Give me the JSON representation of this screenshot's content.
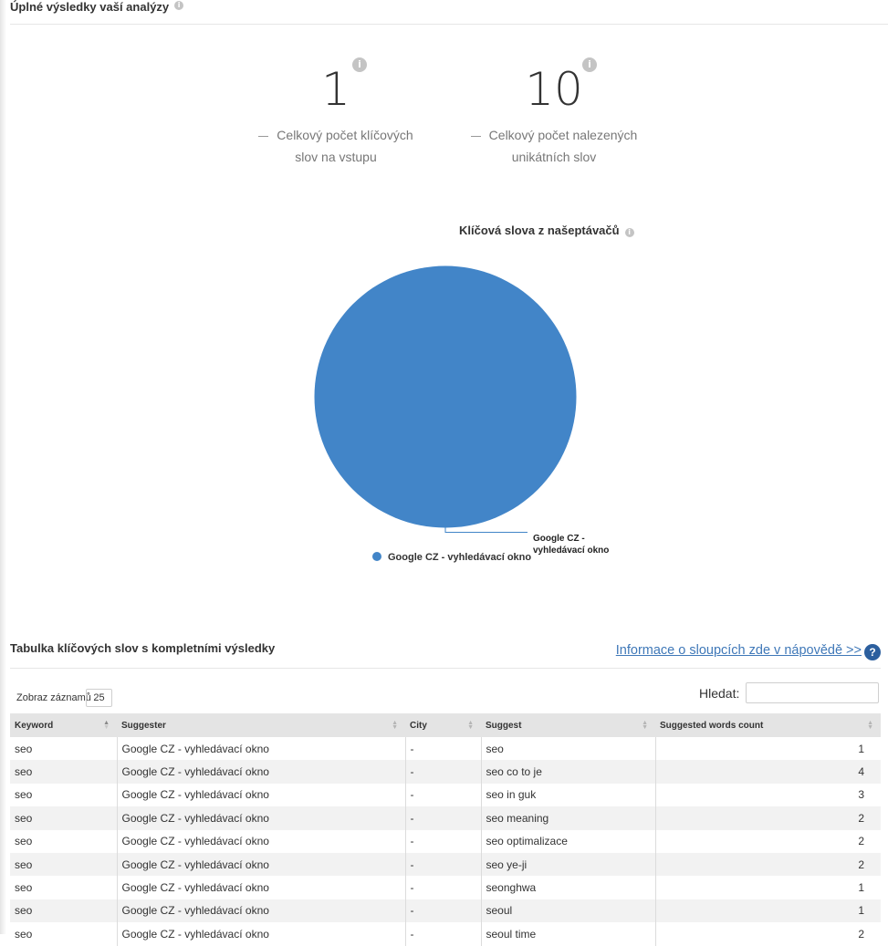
{
  "header": {
    "title": "Úplné výsledky vaší analýzy",
    "info_icon": "i"
  },
  "stats": [
    {
      "value": "1",
      "label_line1": "Celkový počet klíčových",
      "label_line2": "slov na vstupu",
      "info_icon": "i"
    },
    {
      "value": "10",
      "label_line1": "Celkový počet nalezených",
      "label_line2": "unikátních slov",
      "info_icon": "i"
    }
  ],
  "chart_title": "Klíčová slova z našeptávačů",
  "chart_data": {
    "type": "pie",
    "title": "Klíčová slova z našeptávačů",
    "slices": [
      {
        "label": "Google CZ - vyhledávací okno",
        "value": 10,
        "color": "#4285c8"
      }
    ],
    "slice_label_line1": "Google CZ -",
    "slice_label_line2": "vyhledávací okno",
    "legend": {
      "placement": "bottom",
      "entries": [
        "Google CZ - vyhledávací okno"
      ]
    }
  },
  "table_section": {
    "title": "Tabulka klíčových slov s kompletními výsledky",
    "help_link": "Informace o sloupcích zde v nápovědě >>",
    "help_icon": "?",
    "show_label": "Zobraz záznamů",
    "page_size": "25",
    "search_label": "Hledat:",
    "columns": [
      "Keyword",
      "Suggester",
      "City",
      "Suggest",
      "Suggested words count"
    ],
    "rows": [
      [
        "seo",
        "Google CZ - vyhledávací okno",
        "-",
        "seo",
        "1"
      ],
      [
        "seo",
        "Google CZ - vyhledávací okno",
        "-",
        "seo co to je",
        "4"
      ],
      [
        "seo",
        "Google CZ - vyhledávací okno",
        "-",
        "seo in guk",
        "3"
      ],
      [
        "seo",
        "Google CZ - vyhledávací okno",
        "-",
        "seo meaning",
        "2"
      ],
      [
        "seo",
        "Google CZ - vyhledávací okno",
        "-",
        "seo optimalizace",
        "2"
      ],
      [
        "seo",
        "Google CZ - vyhledávací okno",
        "-",
        "seo ye-ji",
        "2"
      ],
      [
        "seo",
        "Google CZ - vyhledávací okno",
        "-",
        "seonghwa",
        "1"
      ],
      [
        "seo",
        "Google CZ - vyhledávací okno",
        "-",
        "seoul",
        "1"
      ],
      [
        "seo",
        "Google CZ - vyhledávací okno",
        "-",
        "seoul time",
        "2"
      ]
    ]
  },
  "colors": {
    "accent": "#4285c8",
    "link": "#3f78b8",
    "help_icon": "#2c5f9e"
  }
}
